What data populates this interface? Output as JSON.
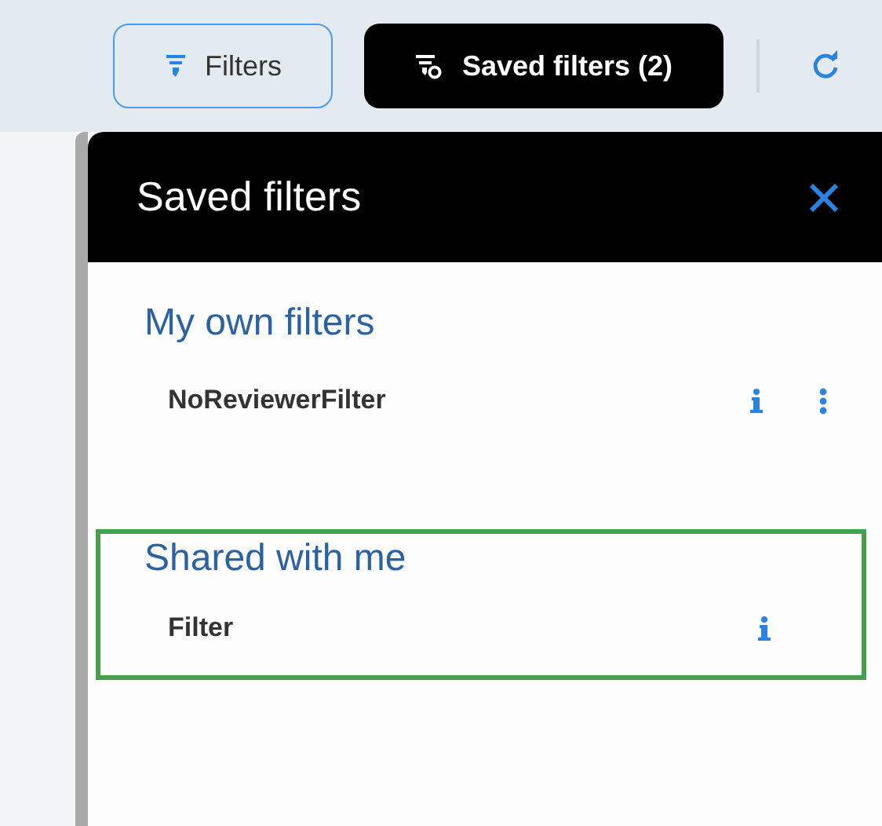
{
  "toolbar": {
    "filters_button": "Filters",
    "saved_filters_button": "Saved filters (2)"
  },
  "panel": {
    "title": "Saved filters",
    "sections": [
      {
        "title": "My own filters",
        "highlighted": false,
        "items": [
          {
            "name": "NoReviewerFilter",
            "has_menu": true
          }
        ]
      },
      {
        "title": "Shared with me",
        "highlighted": true,
        "items": [
          {
            "name": "Filter",
            "has_menu": false
          }
        ]
      }
    ]
  }
}
